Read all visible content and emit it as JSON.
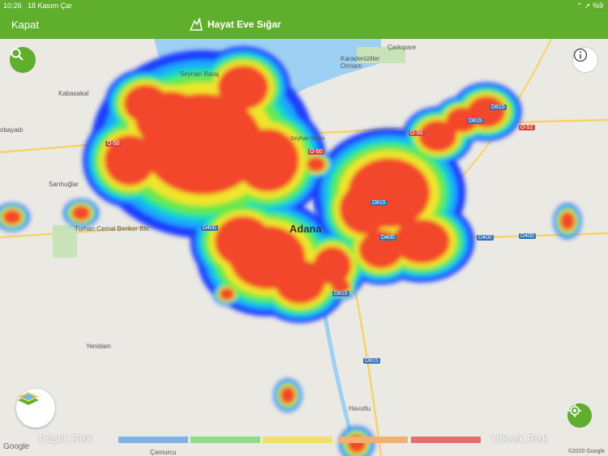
{
  "status_bar": {
    "time": "10:26",
    "date": "18 Kasım Çar",
    "indicators": "⌃ ➚ %9"
  },
  "nav": {
    "close_label": "Kapat",
    "title": "Hayat Eve Sığar"
  },
  "map": {
    "city": "Adana",
    "labels": {
      "lake": "Seyhan Baraj",
      "kabasakal": "Kabasakal",
      "obayadi": "obayadı",
      "sarihuglar": "Sarıhuğlar",
      "turhan": "Turhan Cemal Beriker Blv.",
      "yenidam": "Yenidam",
      "karadeniz": "Karadenizliler Ormanı",
      "carkipare": "Çarkıpare",
      "havutlu": "Havutlu",
      "camurcu": "Çamurcu",
      "seyhan_nehri": "Seyhan Nehri"
    },
    "shields": {
      "o50a": "O-50",
      "o50b": "O-50",
      "o50c": "O-50",
      "o52": "O-52",
      "d400a": "D400",
      "d400b": "D400",
      "d400c": "D400",
      "d400d": "D400",
      "d815a": "D815",
      "d815b": "D815",
      "d815c": "D815",
      "d815d": "D815",
      "d815e": "D815"
    },
    "heat_colors": [
      "#1a3dff",
      "#1ea7ff",
      "#18e0b0",
      "#6be84a",
      "#f0e52a",
      "#f2462a"
    ]
  },
  "legend": {
    "low_label": "Düşük Risk",
    "high_label": "Yüksek Risk",
    "colors": [
      "#7fb2e6",
      "#8fdc86",
      "#f0e06b",
      "#f1b070",
      "#e0706c"
    ]
  },
  "footer": {
    "google": "Google",
    "copyright": "©2020 Google"
  }
}
